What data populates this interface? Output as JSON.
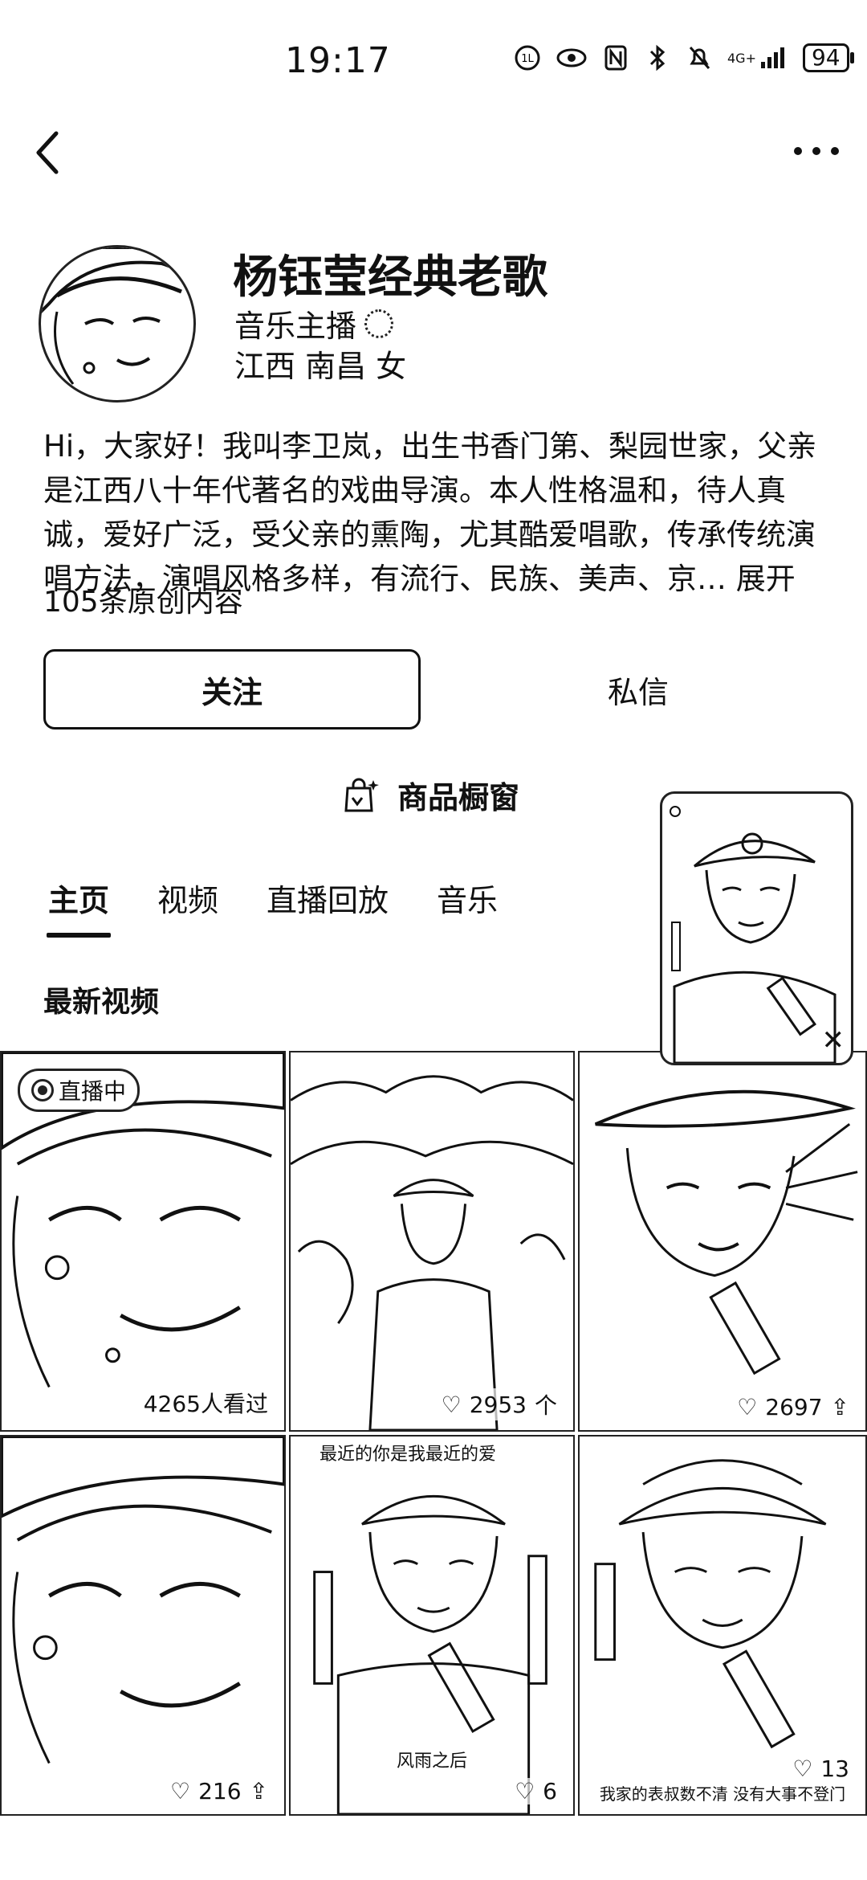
{
  "status_bar": {
    "time": "19:17",
    "network": "4G+",
    "battery": "94"
  },
  "profile": {
    "name": "杨钰莹经典老歌",
    "role": "音乐主播",
    "location": "江西 南昌 女",
    "bio": "Hi，大家好！我叫李卫岚，出生书香门第、梨园世家，父亲是江西八十年代著名的戏曲导演。本人性格温和，待人真诚，爱好广泛，受父亲的熏陶，尤其酷爱唱歌，传承传统演唱方法，演唱风格多样，有流行、民族、美声、京…",
    "bio_more": "展开",
    "original_count": "105条原创内容"
  },
  "actions": {
    "follow": "关注",
    "message": "私信",
    "shop": "商品橱窗"
  },
  "tabs": [
    {
      "label": "主页"
    },
    {
      "label": "视频"
    },
    {
      "label": "直播回放"
    },
    {
      "label": "音乐"
    }
  ],
  "section": {
    "latest_videos": "最新视频"
  },
  "videos": [
    {
      "badge": "直播中",
      "stat": "4265人看过"
    },
    {
      "likes": "2953",
      "stat_suffix": "个"
    },
    {
      "likes": "2697"
    },
    {
      "likes": "216"
    },
    {
      "caption_top": "最近的你是我最近的爱",
      "caption_bottom": "风雨之后",
      "likes": "6"
    },
    {
      "caption_bottom": "我家的表叔数不清 没有大事不登门",
      "likes": "13"
    }
  ],
  "icons": {
    "back": "chevron-left-icon",
    "more": "more-dots-icon",
    "shop": "shopping-bag-icon",
    "close": "close-icon",
    "heart": "heart-icon",
    "share": "share-icon"
  }
}
